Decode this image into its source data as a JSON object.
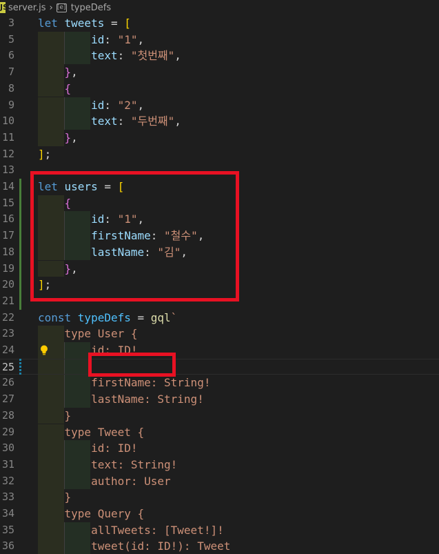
{
  "breadcrumb": {
    "file_name": "server.js",
    "symbol_name": "typeDefs"
  },
  "colors": {
    "highlight": "#e81123",
    "keyword": "#569cd6",
    "variable": "#9cdcfe",
    "string": "#ce9178",
    "bracket_gold": "#ffd700",
    "bracket_purple": "#da70d6",
    "git_added": "#487e3a"
  },
  "lines": [
    {
      "n": "3",
      "tokens": [
        [
          "kw",
          "let "
        ],
        [
          "var",
          "tweets"
        ],
        [
          "op",
          " = "
        ],
        [
          "br",
          "["
        ]
      ]
    },
    {
      "n": "5",
      "tokens": [
        [
          "prop",
          "        id"
        ],
        [
          "op",
          ": "
        ],
        [
          "str",
          "\"1\""
        ],
        [
          "op",
          ","
        ]
      ]
    },
    {
      "n": "6",
      "tokens": [
        [
          "prop",
          "        text"
        ],
        [
          "op",
          ": "
        ],
        [
          "str",
          "\"첫번째\""
        ],
        [
          "op",
          ","
        ]
      ]
    },
    {
      "n": "7",
      "tokens": [
        [
          "br2",
          "    }"
        ],
        [
          "op",
          ","
        ]
      ]
    },
    {
      "n": "8",
      "tokens": [
        [
          "br2",
          "    {"
        ]
      ]
    },
    {
      "n": "9",
      "tokens": [
        [
          "prop",
          "        id"
        ],
        [
          "op",
          ": "
        ],
        [
          "str",
          "\"2\""
        ],
        [
          "op",
          ","
        ]
      ]
    },
    {
      "n": "10",
      "tokens": [
        [
          "prop",
          "        text"
        ],
        [
          "op",
          ": "
        ],
        [
          "str",
          "\"두번째\""
        ],
        [
          "op",
          ","
        ]
      ]
    },
    {
      "n": "11",
      "tokens": [
        [
          "br2",
          "    }"
        ],
        [
          "op",
          ","
        ]
      ]
    },
    {
      "n": "12",
      "tokens": [
        [
          "br",
          "]"
        ],
        [
          "op",
          ";"
        ]
      ]
    },
    {
      "n": "13",
      "tokens": []
    },
    {
      "n": "14",
      "tokens": [
        [
          "kw",
          "let "
        ],
        [
          "var",
          "users"
        ],
        [
          "op",
          " = "
        ],
        [
          "br",
          "["
        ]
      ]
    },
    {
      "n": "15",
      "tokens": [
        [
          "br2",
          "    {"
        ]
      ]
    },
    {
      "n": "16",
      "tokens": [
        [
          "prop",
          "        id"
        ],
        [
          "op",
          ": "
        ],
        [
          "str",
          "\"1\""
        ],
        [
          "op",
          ","
        ]
      ]
    },
    {
      "n": "17",
      "tokens": [
        [
          "prop",
          "        firstName"
        ],
        [
          "op",
          ": "
        ],
        [
          "str",
          "\"철수\""
        ],
        [
          "op",
          ","
        ]
      ]
    },
    {
      "n": "18",
      "tokens": [
        [
          "prop",
          "        lastName"
        ],
        [
          "op",
          ": "
        ],
        [
          "str",
          "\"김\""
        ],
        [
          "op",
          ","
        ]
      ]
    },
    {
      "n": "19",
      "tokens": [
        [
          "br2",
          "    }"
        ],
        [
          "op",
          ","
        ]
      ]
    },
    {
      "n": "20",
      "tokens": [
        [
          "br",
          "]"
        ],
        [
          "op",
          ";"
        ]
      ]
    },
    {
      "n": "21",
      "tokens": []
    },
    {
      "n": "22",
      "tokens": [
        [
          "kw",
          "const "
        ],
        [
          "cst",
          "typeDefs"
        ],
        [
          "op",
          " = "
        ],
        [
          "fn",
          "gql"
        ],
        [
          "tpl",
          "`"
        ]
      ]
    },
    {
      "n": "23",
      "tokens": [
        [
          "tpl",
          "    type User {"
        ]
      ]
    },
    {
      "n": "24",
      "tokens": [
        [
          "tpl",
          "        id: ID!"
        ]
      ]
    },
    {
      "n": "25",
      "tokens": []
    },
    {
      "n": "26",
      "tokens": [
        [
          "tpl",
          "        firstName: String!"
        ]
      ]
    },
    {
      "n": "27",
      "tokens": [
        [
          "tpl",
          "        lastName: String!"
        ]
      ]
    },
    {
      "n": "28",
      "tokens": [
        [
          "tpl",
          "    }"
        ]
      ]
    },
    {
      "n": "29",
      "tokens": [
        [
          "tpl",
          "    type Tweet {"
        ]
      ]
    },
    {
      "n": "30",
      "tokens": [
        [
          "tpl",
          "        id: ID!"
        ]
      ]
    },
    {
      "n": "31",
      "tokens": [
        [
          "tpl",
          "        text: String!"
        ]
      ]
    },
    {
      "n": "32",
      "tokens": [
        [
          "tpl",
          "        author: User"
        ]
      ]
    },
    {
      "n": "33",
      "tokens": [
        [
          "tpl",
          "    }"
        ]
      ]
    },
    {
      "n": "34",
      "tokens": [
        [
          "tpl",
          "    type Query {"
        ]
      ]
    },
    {
      "n": "35",
      "tokens": [
        [
          "tpl",
          "        allTweets: [Tweet!]!"
        ]
      ]
    },
    {
      "n": "36",
      "tokens": [
        [
          "tpl",
          "        tweet(id: ID!): Tweet"
        ]
      ]
    }
  ]
}
